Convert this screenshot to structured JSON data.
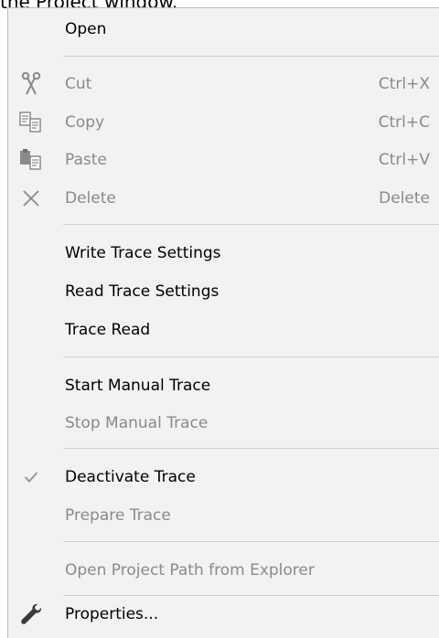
{
  "caption": "the Project window.",
  "menu": {
    "items": [
      {
        "label": "Open",
        "shortcut": "",
        "icon": "",
        "enabled": true
      },
      {
        "label": "Cut",
        "shortcut": "Ctrl+X",
        "icon": "scissors-icon",
        "enabled": false
      },
      {
        "label": "Copy",
        "shortcut": "Ctrl+C",
        "icon": "copy-icon",
        "enabled": false
      },
      {
        "label": "Paste",
        "shortcut": "Ctrl+V",
        "icon": "paste-icon",
        "enabled": false
      },
      {
        "label": "Delete",
        "shortcut": "Delete",
        "icon": "delete-icon",
        "enabled": false
      },
      {
        "label": "Write Trace Settings",
        "shortcut": "",
        "icon": "",
        "enabled": true
      },
      {
        "label": "Read Trace Settings",
        "shortcut": "",
        "icon": "",
        "enabled": true
      },
      {
        "label": "Trace Read",
        "shortcut": "",
        "icon": "",
        "enabled": true
      },
      {
        "label": "Start Manual Trace",
        "shortcut": "",
        "icon": "",
        "enabled": true
      },
      {
        "label": "Stop Manual Trace",
        "shortcut": "",
        "icon": "",
        "enabled": false
      },
      {
        "label": "Deactivate Trace",
        "shortcut": "",
        "icon": "checkmark-icon",
        "enabled": true,
        "checked": true
      },
      {
        "label": "Prepare Trace",
        "shortcut": "",
        "icon": "",
        "enabled": false
      },
      {
        "label": "Open Project Path from Explorer",
        "shortcut": "",
        "icon": "",
        "enabled": false
      },
      {
        "label": "Properties...",
        "shortcut": "",
        "icon": "wrench-icon",
        "enabled": true
      }
    ]
  }
}
